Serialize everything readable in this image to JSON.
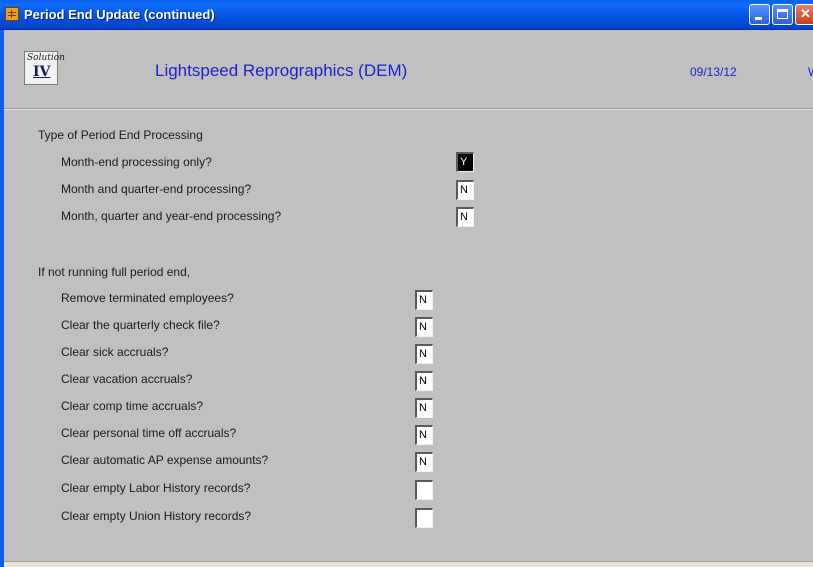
{
  "window": {
    "title": "Period End Update (continued)"
  },
  "header": {
    "logo_top": "Solution",
    "logo_bottom": "IV",
    "company": "Lightspeed Reprographics (DEM)",
    "date": "09/13/12",
    "edge_text": "W"
  },
  "section1": {
    "heading": "Type of Period End Processing",
    "options": [
      {
        "label": "Month-end processing only?",
        "value": "Y"
      },
      {
        "label": "Month and quarter-end processing?",
        "value": "N"
      },
      {
        "label": "Month, quarter and year-end processing?",
        "value": "N"
      }
    ]
  },
  "section2": {
    "heading": "If not running full period end,",
    "options": [
      {
        "label": "Remove terminated employees?",
        "value": "N"
      },
      {
        "label": "Clear the quarterly check file?",
        "value": "N"
      },
      {
        "label": "Clear sick accruals?",
        "value": "N"
      },
      {
        "label": "Clear vacation accruals?",
        "value": "N"
      },
      {
        "label": "Clear comp time accruals?",
        "value": "N"
      },
      {
        "label": "Clear personal time off accruals?",
        "value": "N"
      },
      {
        "label": "Clear automatic AP expense amounts?",
        "value": "N"
      },
      {
        "label": "Clear empty Labor History records?",
        "value": ""
      },
      {
        "label": "Clear empty Union History records?",
        "value": ""
      }
    ]
  },
  "colors": {
    "titlebar": "#0554e3",
    "form_bg": "#c0c0c0",
    "header_text": "#1e1ed2"
  }
}
